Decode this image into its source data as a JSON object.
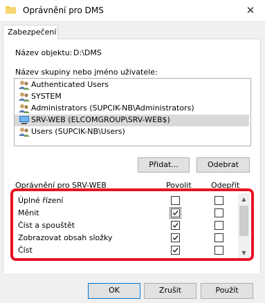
{
  "window": {
    "title": "Oprávnění pro DMS",
    "close_glyph": "✕"
  },
  "tabs": [
    {
      "label": "Zabezpečení"
    }
  ],
  "object": {
    "label": "Název objektu:",
    "value": "D:\\DMS"
  },
  "groups": {
    "label": "Název skupiny nebo jméno uživatele:",
    "items": [
      {
        "label": "Authenticated Users",
        "icon": "users-icon"
      },
      {
        "label": "SYSTEM",
        "icon": "users-icon"
      },
      {
        "label": "Administrators (SUPCIK-NB\\Administrators)",
        "icon": "users-icon"
      },
      {
        "label": "SRV-WEB (ELCOMGROUP\\SRV-WEB$)",
        "icon": "computer-icon",
        "selected": true
      },
      {
        "label": "Users (SUPCIK-NB\\Users)",
        "icon": "users-icon"
      }
    ]
  },
  "buttons": {
    "add": "Přidat...",
    "remove": "Odebrat",
    "ok": "OK",
    "cancel": "Zrušit",
    "apply": "Použít"
  },
  "permissions": {
    "header": "Oprávnění pro SRV-WEB",
    "allow_header": "Povolit",
    "deny_header": "Odepřít",
    "rows": [
      {
        "name": "Úplné řízení",
        "allow": false,
        "deny": false
      },
      {
        "name": "Měnit",
        "allow": true,
        "deny": false
      },
      {
        "name": "Číst a spouštět",
        "allow": true,
        "deny": false
      },
      {
        "name": "Zobrazovat obsah složky",
        "allow": true,
        "deny": false
      },
      {
        "name": "Číst",
        "allow": true,
        "deny": false
      }
    ]
  },
  "colors": {
    "highlight": "#e81123",
    "selection": "#d9d9d9",
    "folder": "#f3c852"
  }
}
